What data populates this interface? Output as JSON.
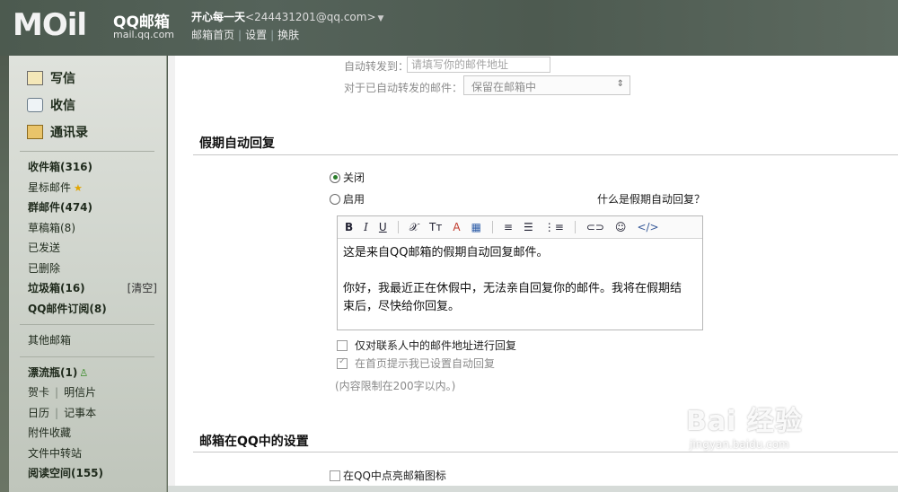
{
  "header": {
    "logo_text": "MOil",
    "logo_cn": "QQ邮箱",
    "logo_url": "mail.qq.com",
    "user_name": "开心每一天",
    "user_email": "<244431201@qq.com>",
    "dropdown_icon": "chevron-down-icon",
    "links": [
      "邮箱首页",
      "设置",
      "换肤"
    ],
    "link_separator": "|"
  },
  "sidebar": {
    "compose": [
      {
        "label": "写信",
        "icon": "pencil-icon"
      },
      {
        "label": "收信",
        "icon": "envelope-icon"
      },
      {
        "label": "通讯录",
        "icon": "address-book-icon"
      }
    ],
    "inbox": "收件箱(316)",
    "starred": "星标邮件",
    "groups": "群邮件(474)",
    "drafts": "草稿箱(8)",
    "sent": "已发送",
    "deleted": "已删除",
    "spam": "垃圾箱(16)",
    "spam_clear": "[清空]",
    "subscription": "QQ邮件订阅(8)",
    "other": "其他邮箱",
    "bottle": "漂流瓶(1)",
    "greeting": "贺卡",
    "postcard": "明信片",
    "calendar": "日历",
    "notes": "记事本",
    "attachments": "附件收藏",
    "file_transfer": "文件中转站",
    "reading": "阅读空间(155)",
    "pipe": "|"
  },
  "forward": {
    "label": "自动转发到：",
    "placeholder": "请填写你的邮件地址",
    "after_label": "对于已自动转发的邮件：",
    "after_value": "保留在邮箱中",
    "after_caret": "⇕"
  },
  "vacation": {
    "title": "假期自动回复",
    "off_label": "关闭",
    "on_label": "启用",
    "selected": "off",
    "help": "什么是假期自动回复？",
    "toolbar": [
      "B",
      "I",
      "U",
      "𝒳",
      "Tт",
      "A",
      "▦",
      "≡",
      "☰",
      "⋮≡",
      "⊂⊃",
      "☺",
      "</>"
    ],
    "body_line1": "这是来自QQ邮箱的假期自动回复邮件。",
    "body_line2": "你好，我最近正在休假中，无法亲自回复你的邮件。我将在假期结",
    "body_line3": "束后，尽快给你回复。",
    "contacts_only": "仅对联系人中的邮件地址进行回复",
    "contacts_only_checked": false,
    "home_hint": "在首页提示我已设置自动回复",
    "home_hint_checked": true,
    "limit_hint": "(内容限制在200字以内。)"
  },
  "qq_settings": {
    "title": "邮箱在QQ中的设置",
    "light_icon": "在QQ中点亮邮箱图标",
    "light_icon_checked": false
  },
  "watermark": {
    "main": "Bai 经验",
    "url": "jingyan.baidu.com"
  }
}
